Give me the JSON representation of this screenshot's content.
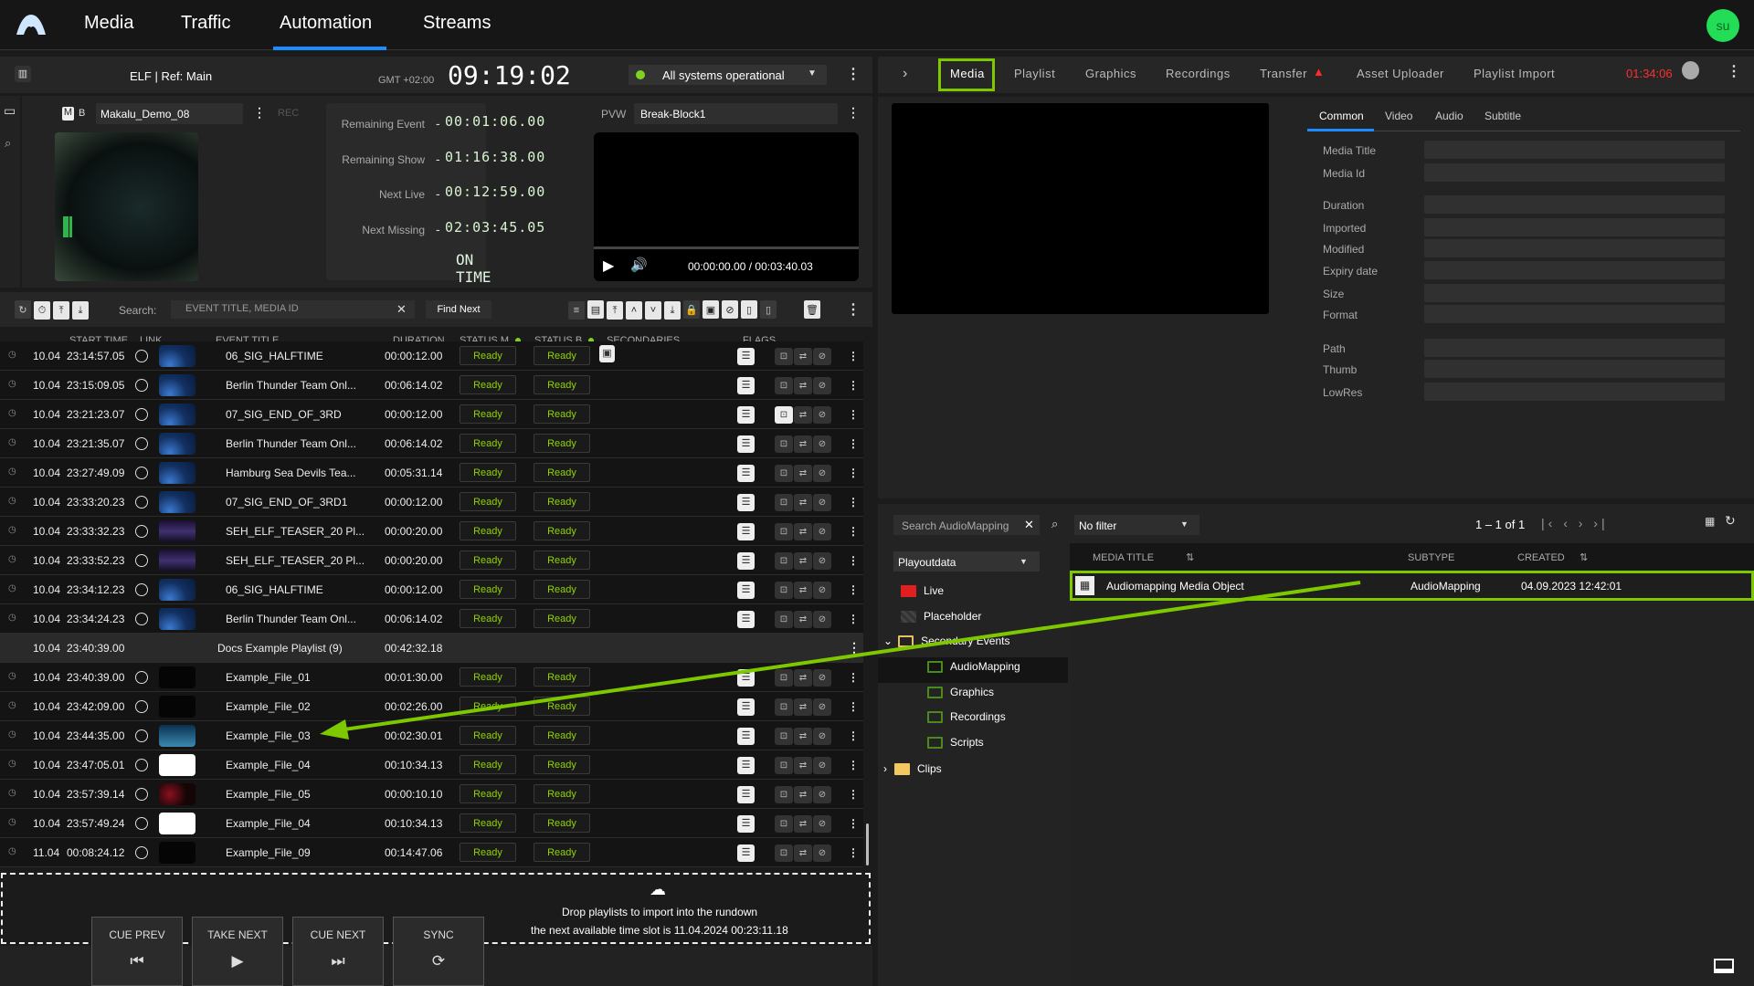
{
  "nav": {
    "tabs": [
      "Media",
      "Traffic",
      "Automation",
      "Streams"
    ],
    "active": "Automation",
    "user_initials": "su"
  },
  "channel": {
    "name": "ELF | Ref: Main",
    "timezone": "GMT +02:00",
    "clock": "09:19:02",
    "system_status": "All systems operational",
    "status_color": "#7ed321"
  },
  "program": {
    "mode_m": "M",
    "mode_b": "B",
    "clip": "Makalu_Demo_08",
    "rec": "REC"
  },
  "timers": [
    {
      "label": "Remaining Event",
      "value": "00:01:06.00"
    },
    {
      "label": "Remaining Show",
      "value": "01:16:38.00"
    },
    {
      "label": "Next Live",
      "value": "00:12:59.00"
    },
    {
      "label": "Next Missing",
      "value": "02:03:45.05"
    }
  ],
  "on_time": "ON TIME",
  "preview": {
    "label": "PVW",
    "clip": "Break-Block1",
    "timecode": "00:00:00.00 / 00:03:40.03"
  },
  "search": {
    "label": "Search:",
    "placeholder": "EVENT TITLE, MEDIA ID",
    "find_next": "Find Next"
  },
  "columns": {
    "start_time": "START TIME",
    "link": "LINK",
    "event_title": "EVENT TITLE",
    "duration": "DURATION",
    "status_m": "STATUS M",
    "status_b": "STATUS B",
    "secondaries": "SECONDARIES",
    "flags": "FLAGS"
  },
  "rows": [
    {
      "date": "10.04",
      "time": "23:14:57.05",
      "thumb": "blue",
      "title": "06_SIG_HALFTIME",
      "duration": "00:00:12.00",
      "status_m": "Ready",
      "status_b": "Ready",
      "secondary": true
    },
    {
      "date": "10.04",
      "time": "23:15:09.05",
      "thumb": "blue",
      "title": "Berlin Thunder Team Onl...",
      "duration": "00:06:14.02",
      "status_m": "Ready",
      "status_b": "Ready"
    },
    {
      "date": "10.04",
      "time": "23:21:23.07",
      "thumb": "blue",
      "title": "07_SIG_END_OF_3RD",
      "duration": "00:00:12.00",
      "status_m": "Ready",
      "status_b": "Ready",
      "flag_active": true
    },
    {
      "date": "10.04",
      "time": "23:21:35.07",
      "thumb": "blue",
      "title": "Berlin Thunder Team Onl...",
      "duration": "00:06:14.02",
      "status_m": "Ready",
      "status_b": "Ready"
    },
    {
      "date": "10.04",
      "time": "23:27:49.09",
      "thumb": "blue",
      "title": "Hamburg Sea Devils Tea...",
      "duration": "00:05:31.14",
      "status_m": "Ready",
      "status_b": "Ready"
    },
    {
      "date": "10.04",
      "time": "23:33:20.23",
      "thumb": "blue",
      "title": "07_SIG_END_OF_3RD1",
      "duration": "00:00:12.00",
      "status_m": "Ready",
      "status_b": "Ready"
    },
    {
      "date": "10.04",
      "time": "23:33:32.23",
      "thumb": "teaser",
      "title": "SEH_ELF_TEASER_20 Pl...",
      "duration": "00:00:20.00",
      "status_m": "Ready",
      "status_b": "Ready"
    },
    {
      "date": "10.04",
      "time": "23:33:52.23",
      "thumb": "teaser",
      "title": "SEH_ELF_TEASER_20 Pl...",
      "duration": "00:00:20.00",
      "status_m": "Ready",
      "status_b": "Ready"
    },
    {
      "date": "10.04",
      "time": "23:34:12.23",
      "thumb": "blue",
      "title": "06_SIG_HALFTIME",
      "duration": "00:00:12.00",
      "status_m": "Ready",
      "status_b": "Ready"
    },
    {
      "date": "10.04",
      "time": "23:34:24.23",
      "thumb": "blue",
      "title": "Berlin Thunder Team Onl...",
      "duration": "00:06:14.02",
      "status_m": "Ready",
      "status_b": "Ready"
    }
  ],
  "playlist_group": {
    "date": "10.04",
    "time": "23:40:39.00",
    "title": "Docs Example Playlist (9)",
    "duration": "00:42:32.18"
  },
  "playlist_rows": [
    {
      "date": "10.04",
      "time": "23:40:39.00",
      "thumb": "black",
      "title": "Example_File_01",
      "duration": "00:01:30.00",
      "status_m": "Ready",
      "status_b": "Ready"
    },
    {
      "date": "10.04",
      "time": "23:42:09.00",
      "thumb": "black",
      "title": "Example_File_02",
      "duration": "00:02:26.00",
      "status_m": "Ready",
      "status_b": "Ready"
    },
    {
      "date": "10.04",
      "time": "23:44:35.00",
      "thumb": "sky",
      "title": "Example_File_03",
      "duration": "00:02:30.01",
      "status_m": "Ready",
      "status_b": "Ready"
    },
    {
      "date": "10.04",
      "time": "23:47:05.01",
      "thumb": "logo",
      "title": "Example_File_04",
      "duration": "00:10:34.13",
      "status_m": "Ready",
      "status_b": "Ready"
    },
    {
      "date": "10.04",
      "time": "23:57:39.14",
      "thumb": "red",
      "title": "Example_File_05",
      "duration": "00:00:10.10",
      "status_m": "Ready",
      "status_b": "Ready"
    },
    {
      "date": "10.04",
      "time": "23:57:49.24",
      "thumb": "logo",
      "title": "Example_File_04",
      "duration": "00:10:34.13",
      "status_m": "Ready",
      "status_b": "Ready"
    },
    {
      "date": "11.04",
      "time": "00:08:24.12",
      "thumb": "black",
      "title": "Example_File_09",
      "duration": "00:14:47.06",
      "status_m": "Ready",
      "status_b": "Ready"
    }
  ],
  "dropzone": {
    "line1": "Drop playlists to import into the rundown",
    "line2": "the next available time slot is 11.04.2024 00:23:11.18"
  },
  "controls": [
    {
      "label": "CUE PREV",
      "icon": "⏮"
    },
    {
      "label": "TAKE NEXT",
      "icon": "▶"
    },
    {
      "label": "CUE NEXT",
      "icon": "⏭"
    },
    {
      "label": "SYNC",
      "icon": "⟳"
    }
  ],
  "right_tabs": {
    "items": [
      "Media",
      "Playlist",
      "Graphics",
      "Recordings",
      "Transfer",
      "Asset Uploader",
      "Playlist Import"
    ],
    "active": "Media",
    "timer": "01:34:06",
    "transfer_warning": true
  },
  "detail_tabs": {
    "items": [
      "Common",
      "Video",
      "Audio",
      "Subtitle"
    ],
    "active": "Common"
  },
  "fields": [
    "Media Title",
    "Media Id",
    "Duration",
    "Imported",
    "Modified",
    "Expiry date",
    "Size",
    "Format",
    "Path",
    "Thumb",
    "LowRes"
  ],
  "browser": {
    "search_placeholder": "Search AudioMapping",
    "filter": "No filter",
    "pagination": "1 – 1 of 1",
    "source": "Playoutdata",
    "tree": [
      "Live",
      "Placeholder",
      "Secondary Events",
      "AudioMapping",
      "Graphics",
      "Recordings",
      "Scripts",
      "Clips"
    ],
    "selected_folder": "AudioMapping",
    "columns": {
      "title": "MEDIA TITLE",
      "subtype": "SUBTYPE",
      "created": "CREATED"
    },
    "items": [
      {
        "title": "Audiomapping Media Object",
        "subtype": "AudioMapping",
        "created": "04.09.2023 12:42:01"
      }
    ]
  },
  "highlight_color": "#7ec800"
}
